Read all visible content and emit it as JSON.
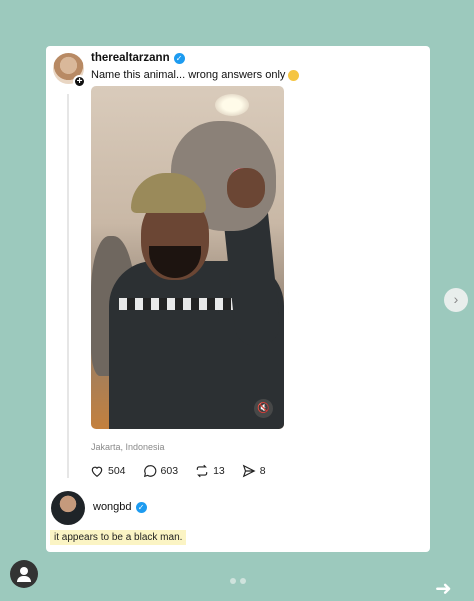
{
  "post": {
    "username": "therealtarzann",
    "caption": "Name this animal... wrong answers only",
    "location": "Jakarta, Indonesia",
    "likes": "504",
    "comments": "603",
    "reposts": "13",
    "shares": "8"
  },
  "reply": {
    "username": "wongbd",
    "text": "it appears to be a black man."
  },
  "icons": {
    "verified": "verified-badge-icon",
    "like": "heart-icon",
    "comment": "comment-bubble-icon",
    "repost": "repost-icon",
    "share": "send-icon",
    "mute": "mute-icon",
    "next": "chevron-right-icon",
    "profile": "user-icon",
    "forward": "arrow-right-icon"
  },
  "colors": {
    "background": "#9cc9bd",
    "verified": "#1d9bf0",
    "highlight": "#fbf4c4"
  }
}
